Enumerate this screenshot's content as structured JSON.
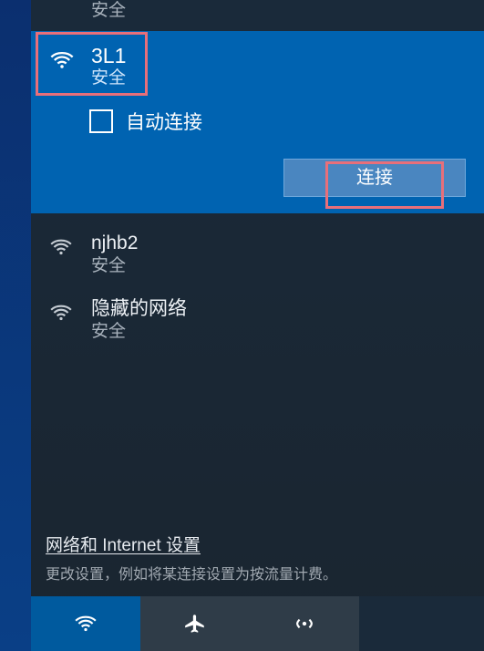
{
  "networks": {
    "top_partial": {
      "security": "安全"
    },
    "selected": {
      "ssid": "3L1",
      "security": "安全",
      "auto_connect_label": "自动连接",
      "connect_button": "连接"
    },
    "second": {
      "ssid": "njhb2",
      "security": "安全"
    },
    "hidden": {
      "ssid": "隐藏的网络",
      "security": "安全"
    }
  },
  "settings": {
    "link": "网络和 Internet 设置",
    "subtitle": "更改设置，例如将某连接设置为按流量计费。"
  },
  "toggles": {
    "wifi": "WLAN",
    "airplane": "飞行模式",
    "hotspot": "移动热点"
  }
}
